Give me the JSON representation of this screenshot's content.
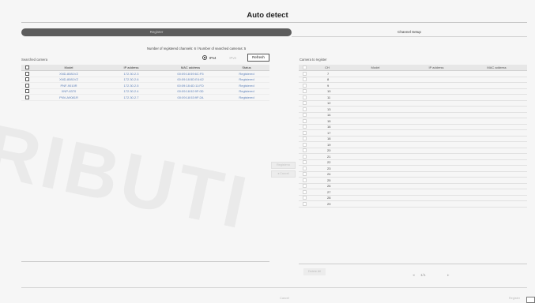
{
  "window": {
    "title": "Auto detect",
    "steps": {
      "active": "Register",
      "next": "Channel Setup"
    }
  },
  "counts_text": "Number of registered channels: 6 / Number of searched cameras: 5",
  "ip_version": {
    "ipv4": "IPv4",
    "ipv6": "IPv6"
  },
  "refresh_label": "Refresh",
  "searched": {
    "label": "Searched camera",
    "columns": [
      "Model",
      "IP address",
      "MAC address",
      "Status"
    ],
    "rows": [
      {
        "model": "XND-8081VZ",
        "ip": "172.30.2.3",
        "mac": "00:09:18:59:6C:F5",
        "status": "Registered"
      },
      {
        "model": "XND-8081VZ",
        "ip": "172.30.2.6",
        "mac": "00:09:18:5D:E4:62",
        "status": "Registered"
      },
      {
        "model": "PNF-9010R",
        "ip": "172.30.2.5",
        "mac": "00:09:18:4D:11:FD",
        "status": "Registered"
      },
      {
        "model": "XNP-6370",
        "ip": "172.30.2.4",
        "mac": "00:09:18:52:9F:0D",
        "status": "Registered"
      },
      {
        "model": "PNV-A9081R",
        "ip": "172.30.2.7",
        "mac": "00:09:18:53:9F:2A",
        "status": "Registered"
      }
    ]
  },
  "to_register": {
    "label": "Camera to register",
    "columns": [
      "CH",
      "Model",
      "IP address",
      "MAC address"
    ],
    "channels": [
      "7",
      "8",
      "9",
      "10",
      "11",
      "12",
      "13",
      "14",
      "15",
      "16",
      "17",
      "18",
      "19",
      "20",
      "21",
      "22",
      "23",
      "24",
      "25",
      "26",
      "27",
      "28",
      "29"
    ]
  },
  "middle_buttons": {
    "register": "Register ▸",
    "cancel": "◂ Cancel"
  },
  "pager": {
    "text": "1/1",
    "prev": "◂",
    "next": "▸"
  },
  "bottom": {
    "left_button": "",
    "delete_label": "Delete All",
    "ok_label": "Register",
    "mid_label": "Cancel"
  },
  "watermark": "RIBUTI"
}
